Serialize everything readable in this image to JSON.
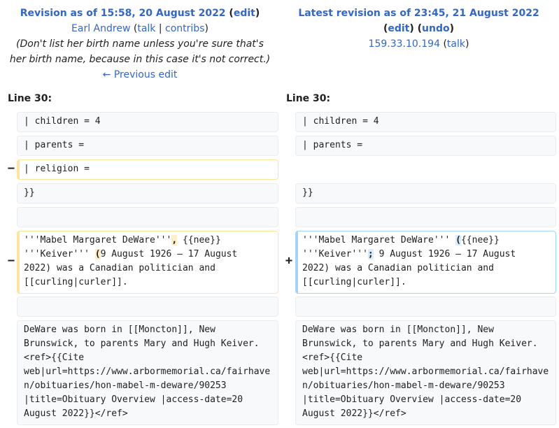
{
  "left_header": {
    "title": "Revision as of 15:58, 20 August 2022",
    "edit": "edit",
    "user": "Earl Andrew",
    "talk": "talk",
    "contribs": "contribs",
    "summary_1": "(Don't list her birth name unless you're sure that's",
    "summary_2": "her birth name, because in this case it's not correct.)",
    "prev_edit": "← Previous edit"
  },
  "right_header": {
    "title": "Latest revision as of 23:45, 21 August 2022",
    "edit": "edit",
    "undo": "undo",
    "user": "159.33.10.194",
    "talk": "talk"
  },
  "line_left": "Line 30:",
  "line_right": "Line 30:",
  "markers": {
    "minus": "−",
    "plus": "+"
  },
  "rows": {
    "children": "| children = 4",
    "parents": "| parents =",
    "religion": "| religion =",
    "close": "}}",
    "p1_left_a": "'''Mabel Margaret DeWare'''",
    "p1_left_del": ",",
    "p1_left_b": " {{nee}}\n'''Keiver''' ",
    "p1_left_del2": "(",
    "p1_left_c": "9 August 1926 – 17 August\n2022) was a Canadian politician and\n[[curling|curler]].",
    "p1_right_a": "'''Mabel Margaret DeWare''' ",
    "p1_right_add": "(",
    "p1_right_b": "{{nee}}\n'''Keiver'''",
    "p1_right_add2": ";",
    "p1_right_c": " 9 August 1926 – 17 August\n2022) was a Canadian politician and\n[[curling|curler]].",
    "p2": "DeWare was born in [[Moncton]], New\nBrunswick, to parents Mary and Hugh Keiver.\n<ref>{{Cite\nweb|url=https://www.arbormemorial.ca/fairhave\nn/obituaries/hon-mabel-m-deware/90253\n|title=Obituary Overview |access-date=20\nAugust 2022}}</ref>"
  }
}
